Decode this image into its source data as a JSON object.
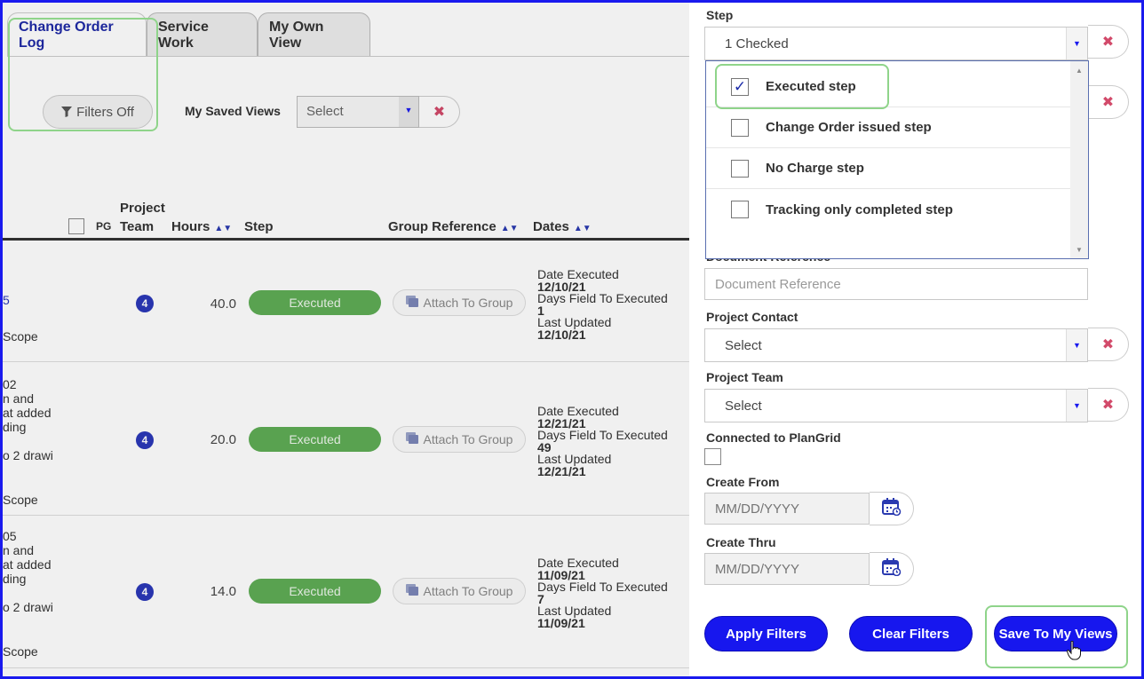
{
  "tabs": [
    {
      "label": "Change Order Log",
      "active": true
    },
    {
      "label": "Service Work",
      "active": false
    },
    {
      "label": "My Own View",
      "active": false
    }
  ],
  "toolbar": {
    "filters_label": "Filters Off",
    "saved_views_label": "My Saved Views",
    "saved_views_placeholder": "Select"
  },
  "table": {
    "headers": {
      "pg": "PG",
      "project_team": [
        "Project",
        "Team"
      ],
      "hours": "Hours",
      "step": "Step",
      "group_reference": "Group Reference",
      "dates": "Dates"
    },
    "rows": [
      {
        "frag_top": [
          "5"
        ],
        "frag_bottom": "Scope",
        "team": "4",
        "hours": "40.0",
        "step": "Executed",
        "attach": "Attach To Group",
        "date_executed_label": "Date Executed",
        "date_executed": "12/10/21",
        "days_label": "Days Field To Executed",
        "days": "1",
        "updated_label": "Last Updated",
        "updated": "12/10/21"
      },
      {
        "frag_top": [
          "02",
          "n and",
          "at added",
          "ding",
          "",
          "o 2 drawi"
        ],
        "frag_bottom": "Scope",
        "team": "4",
        "hours": "20.0",
        "step": "Executed",
        "attach": "Attach To Group",
        "date_executed_label": "Date Executed",
        "date_executed": "12/21/21",
        "days_label": "Days Field To Executed",
        "days": "49",
        "updated_label": "Last Updated",
        "updated": "12/21/21"
      },
      {
        "frag_top": [
          "05",
          "n and",
          "at added",
          "ding",
          "",
          "o 2 drawi"
        ],
        "frag_bottom": "Scope",
        "team": "4",
        "hours": "14.0",
        "step": "Executed",
        "attach": "Attach To Group",
        "date_executed_label": "Date Executed",
        "date_executed": "11/09/21",
        "days_label": "Days Field To Executed",
        "days": "7",
        "updated_label": "Last Updated",
        "updated": "11/09/21"
      }
    ]
  },
  "filters": {
    "step_label": "Step",
    "step_value": "1 Checked",
    "step_options": [
      {
        "label": "Executed step",
        "checked": true
      },
      {
        "label": "Change Order issued step",
        "checked": false
      },
      {
        "label": "No Charge step",
        "checked": false
      },
      {
        "label": "Tracking only completed step",
        "checked": false
      }
    ],
    "document_reference_label": "Document Reference",
    "document_reference_placeholder": "Document Reference",
    "project_contact_label": "Project Contact",
    "project_contact_value": "Select",
    "project_team_label": "Project Team",
    "project_team_value": "Select",
    "plangrid_label": "Connected to PlanGrid",
    "create_from_label": "Create From",
    "create_from_placeholder": "MM/DD/YYYY",
    "create_thru_label": "Create Thru",
    "create_thru_placeholder": "MM/DD/YYYY"
  },
  "actions": {
    "apply": "Apply Filters",
    "clear": "Clear Filters",
    "save": "Save To My Views"
  },
  "colors": {
    "accent_blue": "#1717ee",
    "step_green": "#5fad56",
    "badge_blue": "#2b38b8",
    "clear_red": "#d24a6a",
    "highlight_green": "#8fd48a"
  }
}
